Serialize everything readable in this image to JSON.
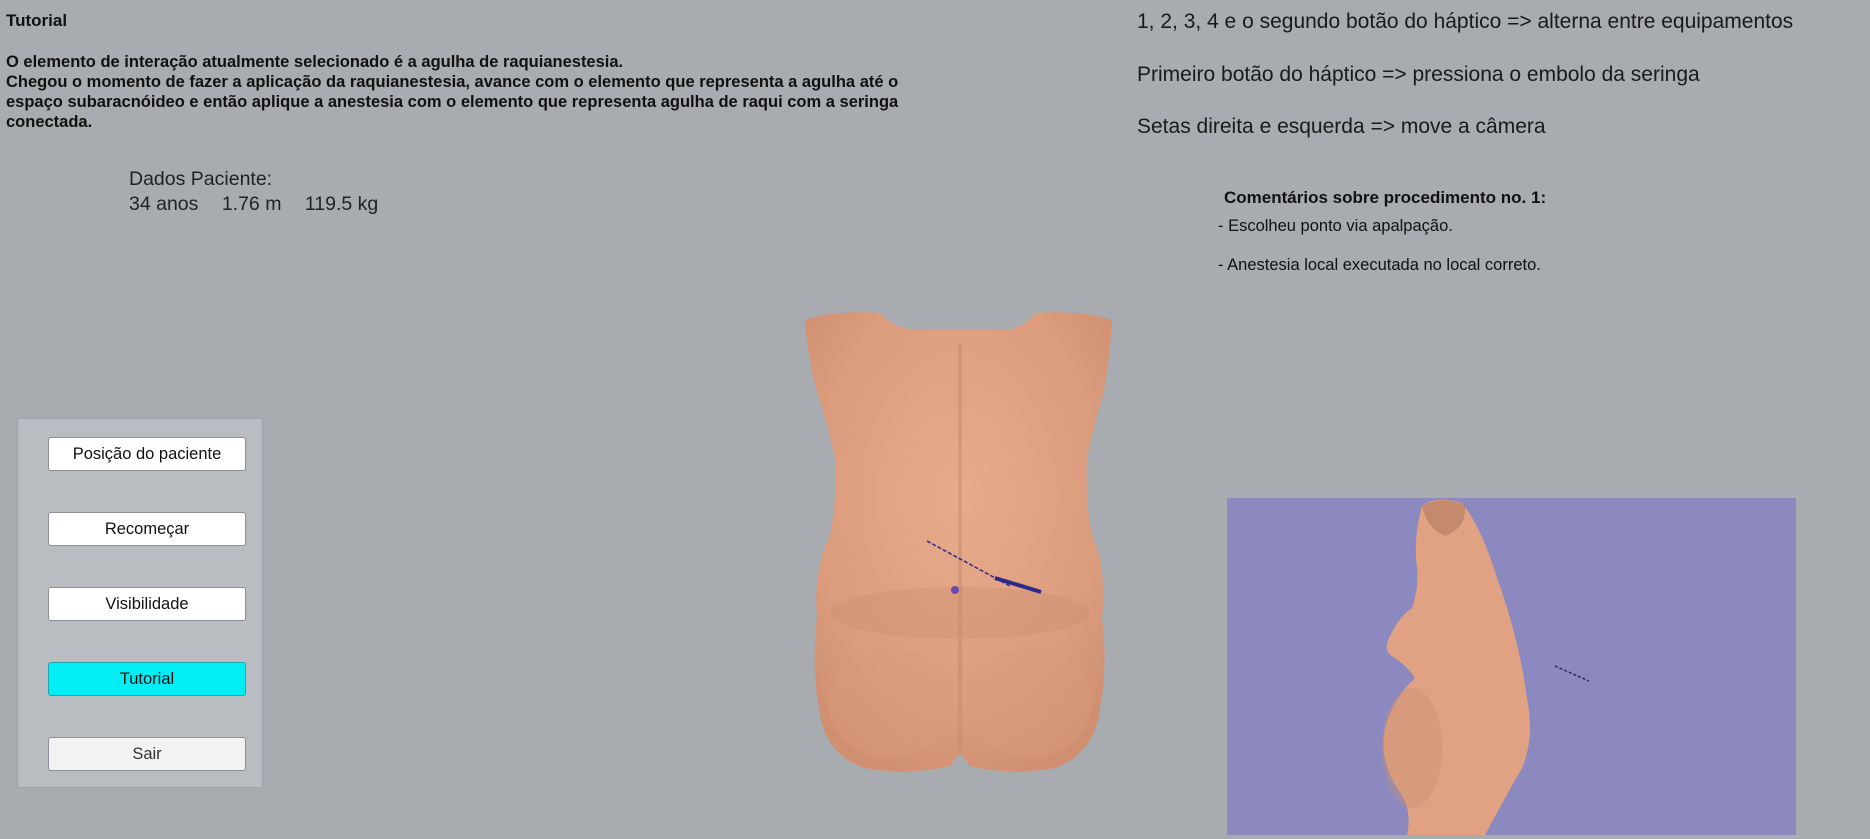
{
  "tutorial_title": "Tutorial",
  "instructions": {
    "line1": "O elemento de interação atualmente selecionado é a agulha de raquianestesia.",
    "line2": "Chegou o momento de fazer a aplicação da raquianestesia, avance com o elemento que representa a agulha até o",
    "line3": "espaço subaracnóideo e então aplique a anestesia com o elemento que representa agulha de raqui com a seringa",
    "line4": "conectada."
  },
  "patient": {
    "label": "Dados Paciente:",
    "age": "34 anos",
    "height": "1.76 m",
    "weight": "119.5 kg"
  },
  "controls_help": [
    "1, 2, 3, 4 e o segundo botão do háptico => alterna entre equipamentos",
    "Primeiro botão do háptico => pressiona o embolo da seringa",
    "Setas direita e esquerda => move a câmera"
  ],
  "comments": {
    "title": "Comentários sobre procedimento no. 1:",
    "items": [
      "- Escolheu ponto via apalpação.",
      "- Anestesia local executada no local correto."
    ]
  },
  "menu": {
    "buttons": [
      "Posição do paciente",
      "Recomeçar",
      "Visibilidade",
      "Tutorial",
      "Sair"
    ],
    "active": "Tutorial"
  },
  "colors": {
    "background": "#a8abb0",
    "active_button": "#00eef4",
    "side_view_background": "#8b89c0",
    "skin": "#e2a283",
    "needle": "#2a2a8a"
  }
}
